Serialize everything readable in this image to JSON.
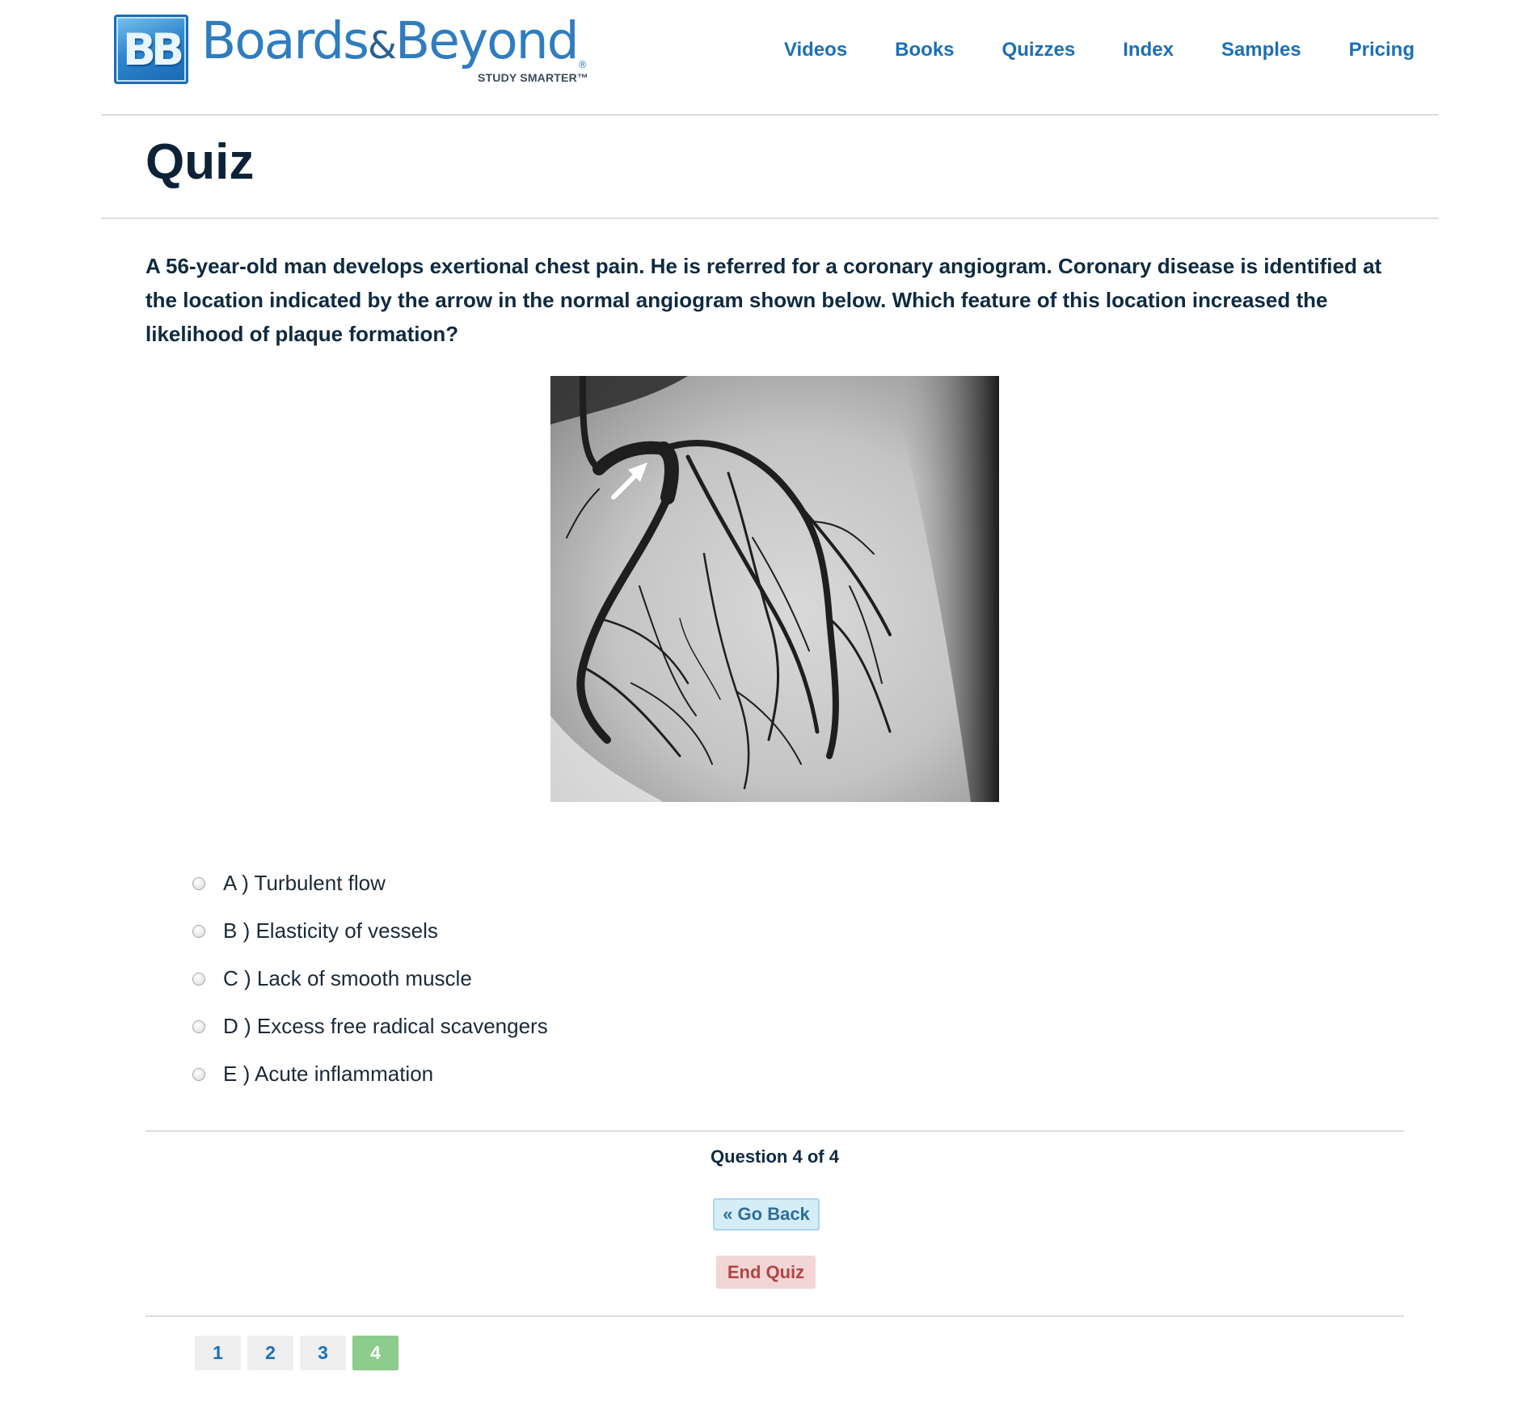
{
  "brand": {
    "logo_initials": "BB",
    "logo_word_left": "Boards",
    "logo_amp": "&",
    "logo_word_right": "Beyond",
    "logo_registered": "®",
    "tagline": "STUDY SMARTER™"
  },
  "nav": {
    "items": [
      {
        "label": "Videos"
      },
      {
        "label": "Books"
      },
      {
        "label": "Quizzes"
      },
      {
        "label": "Index"
      },
      {
        "label": "Samples"
      },
      {
        "label": "Pricing"
      }
    ]
  },
  "page": {
    "title": "Quiz"
  },
  "question": {
    "text": "A 56-year-old man develops exertional chest pain. He is referred for a coronary angiogram. Coronary disease is identified at the location indicated by the arrow in the normal angiogram shown below. Which feature of this location increased the likelihood of plaque formation?",
    "options": [
      {
        "label": "A ) Turbulent flow"
      },
      {
        "label": "B ) Elasticity of vessels"
      },
      {
        "label": "C ) Lack of smooth muscle"
      },
      {
        "label": "D ) Excess free radical scavengers"
      },
      {
        "label": "E ) Acute inflammation"
      }
    ]
  },
  "footer": {
    "question_counter": "Question 4 of 4",
    "go_back_label": "« Go Back",
    "end_quiz_label": "End Quiz",
    "pages": [
      {
        "label": "1",
        "active": false
      },
      {
        "label": "2",
        "active": false
      },
      {
        "label": "3",
        "active": false
      },
      {
        "label": "4",
        "active": true
      }
    ]
  },
  "colors": {
    "nav_link": "#1c70b5",
    "title": "#0d2236",
    "go_back_bg": "#d5edf7",
    "end_quiz_bg": "#f2d5d5",
    "active_page_bg": "#8ccc8c"
  }
}
